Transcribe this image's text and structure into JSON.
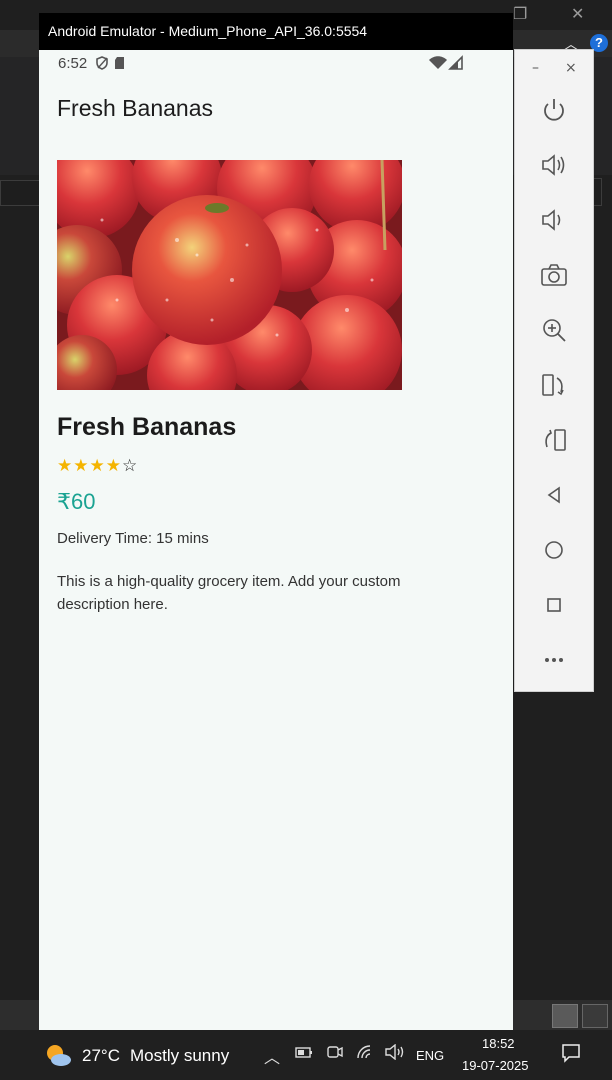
{
  "emulator": {
    "window_title": "Android Emulator - Medium_Phone_API_36.0:5554",
    "status_time": "6:52"
  },
  "app": {
    "appbar_title": "Fresh Bananas",
    "product": {
      "name": "Fresh Bananas",
      "rating": 4,
      "rating_max": 5,
      "price": "₹60",
      "delivery": "Delivery Time: 15 mins",
      "description": "This is a high-quality grocery item. Add your custom description here."
    }
  },
  "side_panel": {
    "minimize": "–",
    "close": "×",
    "buttons": [
      "power-icon",
      "volume-up-icon",
      "volume-down-icon",
      "camera-icon",
      "zoom-icon",
      "rotate-left-icon",
      "rotate-right-icon",
      "back-icon",
      "home-icon",
      "overview-icon",
      "more-icon"
    ]
  },
  "taskbar": {
    "temperature": "27°C",
    "weather": "Mostly sunny",
    "language": "ENG",
    "time": "18:52",
    "date": "19-07-2025"
  },
  "colors": {
    "accent_price": "#1aa392",
    "star": "#f4b400",
    "app_background": "#f4f9f7"
  }
}
